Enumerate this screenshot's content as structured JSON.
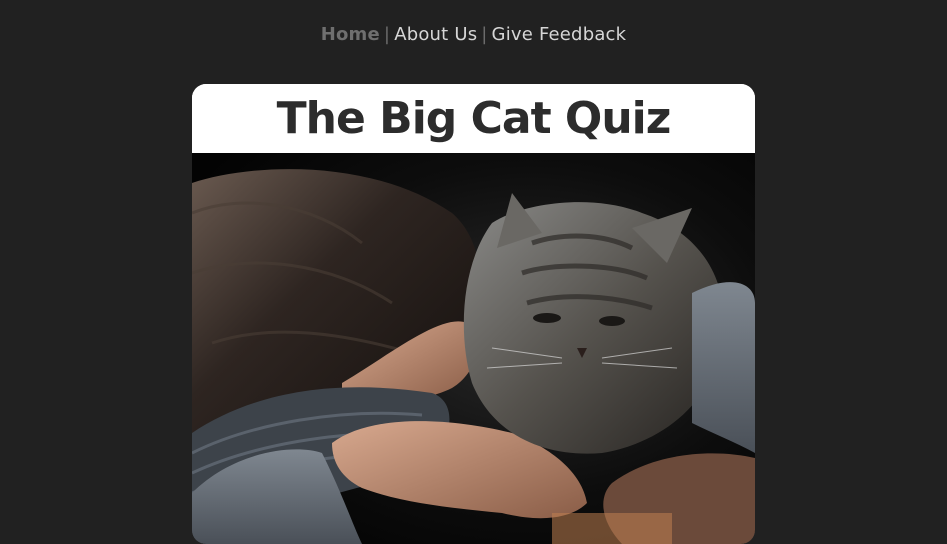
{
  "nav": {
    "items": [
      {
        "label": "Home",
        "active": true
      },
      {
        "label": "About Us",
        "active": false
      },
      {
        "label": "Give Feedback",
        "active": false
      }
    ],
    "separator": "|"
  },
  "card": {
    "title": "The Big Cat Quiz",
    "image_subject": "girl-with-tabby-cat-photo"
  },
  "colors": {
    "background": "#212121",
    "nav_text": "#d6d6d6",
    "nav_active": "#6f6f6f",
    "title": "#2c2c2c",
    "card_header": "#ffffff"
  }
}
